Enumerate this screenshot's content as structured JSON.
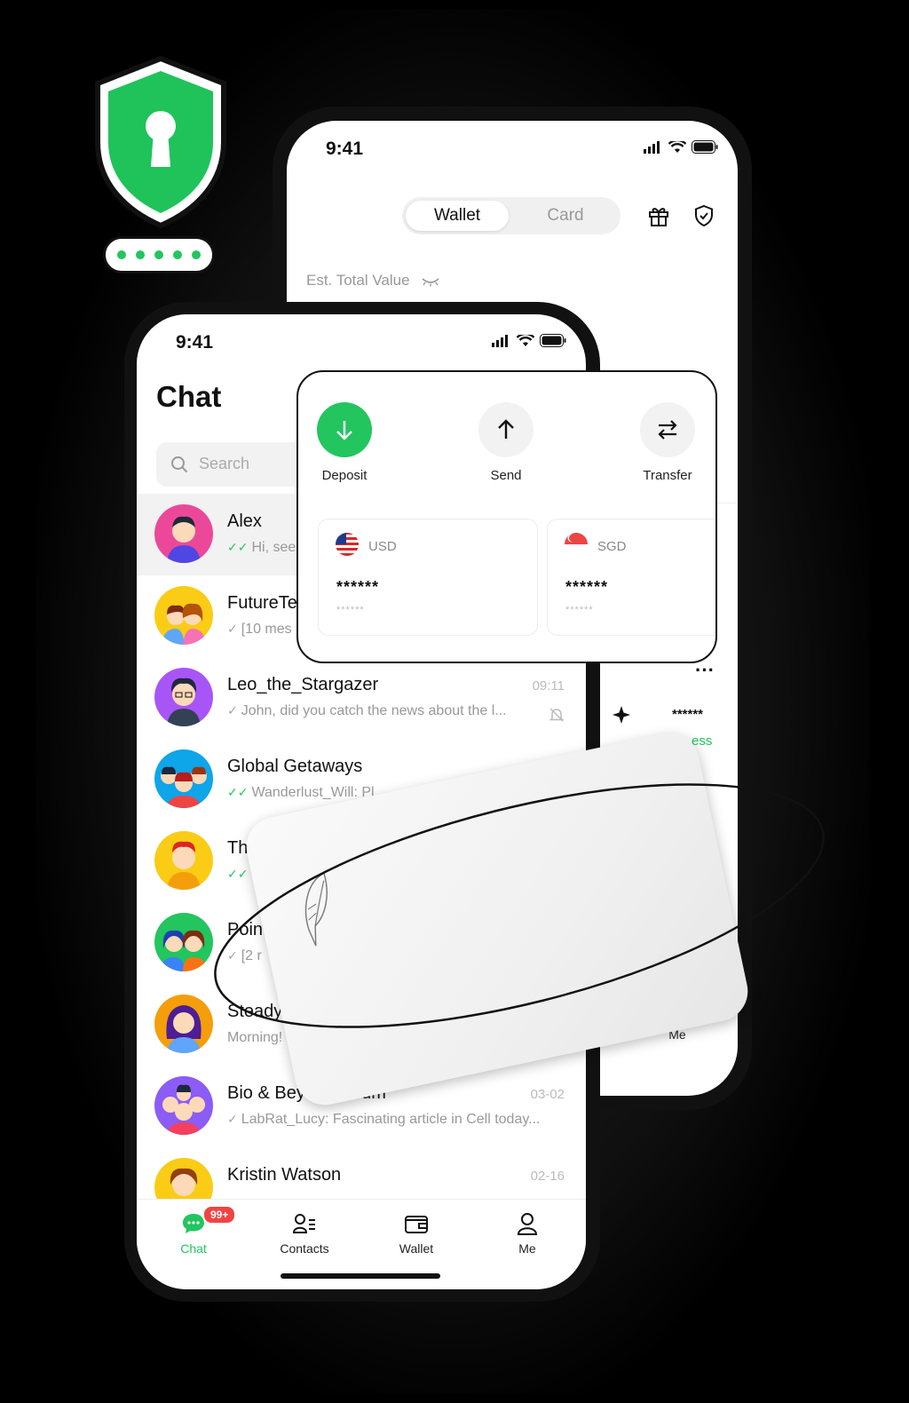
{
  "wallet_screen": {
    "status_time": "9:41",
    "segment": {
      "active": "Wallet",
      "inactive": "Card"
    },
    "est_label": "Est. Total Value",
    "partial": {
      "more": "···",
      "masked": "******",
      "success": "ess",
      "me_label": "Me"
    }
  },
  "chat_screen": {
    "status_time": "9:41",
    "title": "Chat",
    "search_placeholder": "Search",
    "conversations": [
      {
        "name": "Alex",
        "time": "",
        "message": "Hi, seei",
        "read": "double-green"
      },
      {
        "name": "FutureTe",
        "time": "",
        "message": "[10 mes",
        "read": "single"
      },
      {
        "name": "Leo_the_Stargazer",
        "time": "09:11",
        "message": "John, did you catch the news about the l...",
        "read": "single"
      },
      {
        "name": "Global Getaways",
        "time": "",
        "message": "Wanderlust_Will: Pl",
        "read": "double-green"
      },
      {
        "name": "Th",
        "time": "",
        "message": "",
        "read": "double-green"
      },
      {
        "name": "Poin",
        "time": "",
        "message": "[2 r",
        "read": "single"
      },
      {
        "name": "Steady",
        "time": "",
        "message": "Morning!",
        "read": "none"
      },
      {
        "name": "Bio & Beyo... Forum",
        "time": "03-02",
        "message": "LabRat_Lucy: Fascinating article in Cell today...",
        "read": "single"
      },
      {
        "name": "Kristin Watson",
        "time": "02-16",
        "message": "",
        "read": "none"
      }
    ],
    "tabs": [
      {
        "label": "Chat",
        "badge": "99+",
        "active": true
      },
      {
        "label": "Contacts"
      },
      {
        "label": "Wallet"
      },
      {
        "label": "Me"
      }
    ]
  },
  "actions_card": {
    "actions": [
      {
        "label": "Deposit",
        "icon": "arrow-down-icon"
      },
      {
        "label": "Send",
        "icon": "arrow-up-icon"
      },
      {
        "label": "Transfer",
        "icon": "swap-icon"
      }
    ],
    "currencies": [
      {
        "code": "USD",
        "flag": "us-flag-icon",
        "masked": "******",
        "masked_small": "******"
      },
      {
        "code": "SGD",
        "flag": "sg-flag-icon",
        "masked": "******",
        "masked_small": "******"
      }
    ]
  },
  "colors": {
    "accent": "#22c55e",
    "badge": "#ef4444",
    "dark": "#111111"
  }
}
